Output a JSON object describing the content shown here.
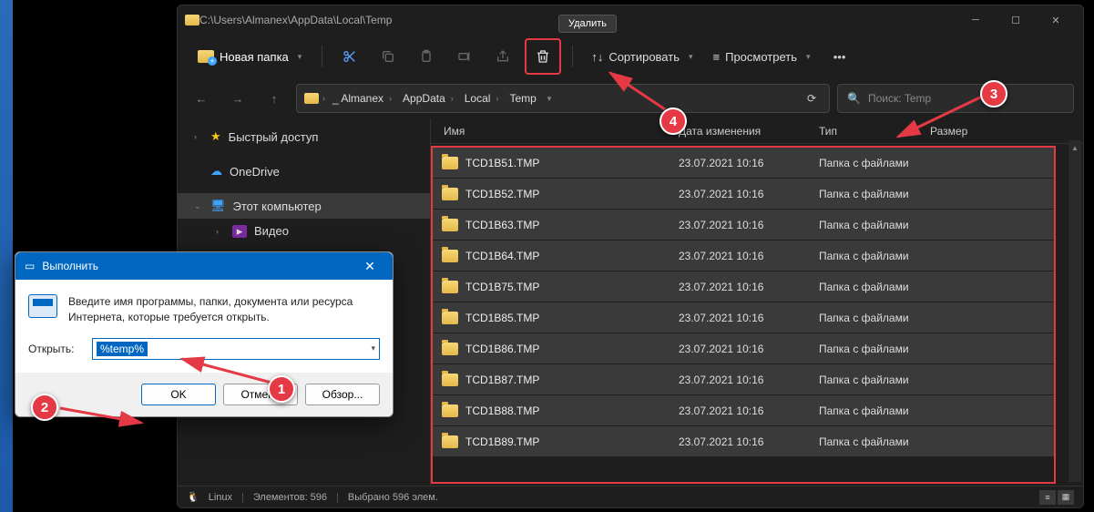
{
  "explorer": {
    "title_path": "C:\\Users\\Almanex\\AppData\\Local\\Temp",
    "new_folder": "Новая папка",
    "tooltip_delete": "Удалить",
    "sort": "Сортировать",
    "view": "Просмотреть",
    "breadcrumbs": [
      "_ Almanex",
      "AppData",
      "Local",
      "Temp"
    ],
    "search_placeholder": "Поиск: Temp",
    "columns": {
      "name": "Имя",
      "date": "Дата изменения",
      "type": "Тип",
      "size": "Размер"
    },
    "sidebar": {
      "quick": "Быстрый доступ",
      "onedrive": "OneDrive",
      "thispc": "Этот компьютер",
      "video": "Видео",
      "linux": "Linux"
    },
    "files": [
      {
        "name": "TCD1B51.TMP",
        "date": "23.07.2021 10:16",
        "type": "Папка с файлами"
      },
      {
        "name": "TCD1B52.TMP",
        "date": "23.07.2021 10:16",
        "type": "Папка с файлами"
      },
      {
        "name": "TCD1B63.TMP",
        "date": "23.07.2021 10:16",
        "type": "Папка с файлами"
      },
      {
        "name": "TCD1B64.TMP",
        "date": "23.07.2021 10:16",
        "type": "Папка с файлами"
      },
      {
        "name": "TCD1B75.TMP",
        "date": "23.07.2021 10:16",
        "type": "Папка с файлами"
      },
      {
        "name": "TCD1B85.TMP",
        "date": "23.07.2021 10:16",
        "type": "Папка с файлами"
      },
      {
        "name": "TCD1B86.TMP",
        "date": "23.07.2021 10:16",
        "type": "Папка с файлами"
      },
      {
        "name": "TCD1B87.TMP",
        "date": "23.07.2021 10:16",
        "type": "Папка с файлами"
      },
      {
        "name": "TCD1B88.TMP",
        "date": "23.07.2021 10:16",
        "type": "Папка с файлами"
      },
      {
        "name": "TCD1B89.TMP",
        "date": "23.07.2021 10:16",
        "type": "Папка с файлами"
      }
    ],
    "status": {
      "elements": "Элементов: 596",
      "selected": "Выбрано 596 элем."
    }
  },
  "run": {
    "title": "Выполнить",
    "message": "Введите имя программы, папки, документа или ресурса Интернета, которые требуется открыть.",
    "open_label": "Открыть:",
    "value": "%temp%",
    "ok": "OK",
    "cancel": "Отмена",
    "browse": "Обзор..."
  },
  "badges": {
    "1": "1",
    "2": "2",
    "3": "3",
    "4": "4"
  }
}
